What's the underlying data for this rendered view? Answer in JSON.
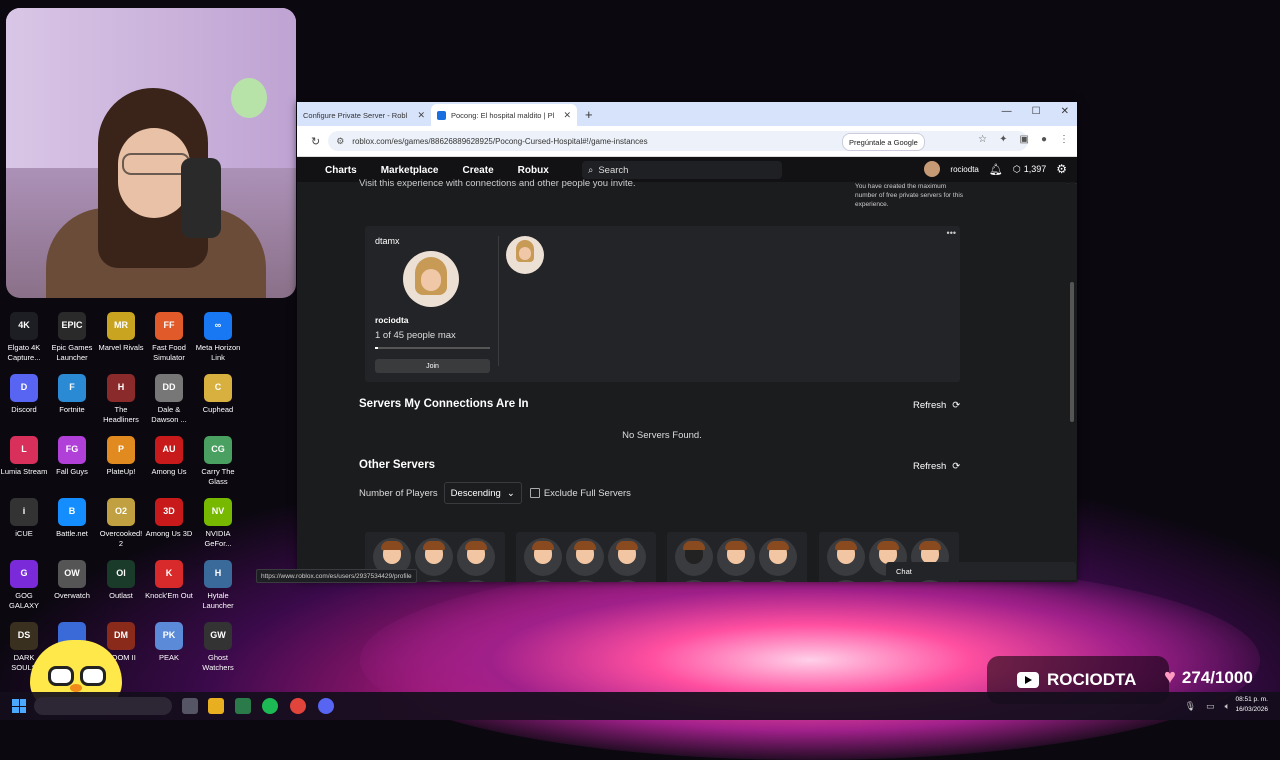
{
  "browser": {
    "tabs": [
      {
        "label": "Configure Private Server - Robl",
        "active": false
      },
      {
        "label": "Pocong: El hospital maldito | Pl",
        "active": true
      }
    ],
    "url": "roblox.com/es/games/88626889628925/Pocong-Cursed-Hospital#!/game-instances",
    "ask_google": "Pregúntale a Google",
    "status_url": "https://www.roblox.com/es/users/2937534429/profile"
  },
  "roblox_nav": {
    "links": [
      "Charts",
      "Marketplace",
      "Create",
      "Robux"
    ],
    "search_placeholder": "Search",
    "username": "rociodta",
    "robux": "1,397"
  },
  "page": {
    "intro": "Visit this experience with connections and other people you invite.",
    "private_note": "You have created the maximum number of free private servers for this experience.",
    "private_server": {
      "owner": "dtamx",
      "name": "rociodta",
      "capacity": "1 of 45 people max",
      "fill_fraction": 0.022,
      "join": "Join"
    },
    "connections": {
      "title": "Servers My Connections Are In",
      "refresh": "Refresh",
      "empty": "No Servers Found."
    },
    "other": {
      "title": "Other Servers",
      "refresh": "Refresh",
      "filter_label": "Number of Players",
      "sort": "Descending",
      "exclude": "Exclude Full Servers",
      "servers": [
        {
          "extra": "+33"
        },
        {
          "extra": "+29"
        },
        {
          "extra": "+28"
        },
        {
          "extra": ""
        }
      ]
    },
    "chat": "Chat"
  },
  "desktop_icons": [
    {
      "label": "Elgato 4K Capture...",
      "abbr": "4K",
      "color": "#1d1d24"
    },
    {
      "label": "Epic Games Launcher",
      "abbr": "EPIC",
      "color": "#2a2a2a"
    },
    {
      "label": "Marvel Rivals",
      "abbr": "MR",
      "color": "#c8a420"
    },
    {
      "label": "Fast Food Simulator",
      "abbr": "FF",
      "color": "#e05a2a"
    },
    {
      "label": "Meta Horizon Link",
      "abbr": "∞",
      "color": "#1877f2"
    },
    {
      "label": "Discord",
      "abbr": "D",
      "color": "#5865f2"
    },
    {
      "label": "Fortnite",
      "abbr": "F",
      "color": "#2a8ad4"
    },
    {
      "label": "The Headliners",
      "abbr": "H",
      "color": "#8a2a2a"
    },
    {
      "label": "Dale & Dawson ...",
      "abbr": "DD",
      "color": "#777"
    },
    {
      "label": "Cuphead",
      "abbr": "C",
      "color": "#d8b040"
    },
    {
      "label": "Lumia Stream",
      "abbr": "L",
      "color": "#d8305a"
    },
    {
      "label": "Fall Guys",
      "abbr": "FG",
      "color": "#b040d8"
    },
    {
      "label": "PlateUp!",
      "abbr": "P",
      "color": "#e08a20"
    },
    {
      "label": "Among Us",
      "abbr": "AU",
      "color": "#c81a1a"
    },
    {
      "label": "Carry The Glass",
      "abbr": "CG",
      "color": "#4aa060"
    },
    {
      "label": "iCUE",
      "abbr": "i",
      "color": "#333"
    },
    {
      "label": "Battle.net",
      "abbr": "B",
      "color": "#148eff"
    },
    {
      "label": "Overcooked! 2",
      "abbr": "O2",
      "color": "#c0a040"
    },
    {
      "label": "Among Us 3D",
      "abbr": "3D",
      "color": "#c81a1a"
    },
    {
      "label": "NVIDIA GeFor...",
      "abbr": "NV",
      "color": "#76b900"
    },
    {
      "label": "GOG GALAXY",
      "abbr": "G",
      "color": "#7a2ad8"
    },
    {
      "label": "Overwatch",
      "abbr": "OW",
      "color": "#555"
    },
    {
      "label": "Outlast",
      "abbr": "Ol",
      "color": "#1a3a2a"
    },
    {
      "label": "Knock'Em Out",
      "abbr": "K",
      "color": "#d82a2a"
    },
    {
      "label": "Hytale Launcher",
      "abbr": "H",
      "color": "#3a6a9a"
    },
    {
      "label": "DARK SOULS",
      "abbr": "DS",
      "color": "#3a3020"
    },
    {
      "label": "",
      "abbr": "",
      "color": "#3a6ad8"
    },
    {
      "label": "DOOM II",
      "abbr": "DM",
      "color": "#8a2a1a"
    },
    {
      "label": "PEAK",
      "abbr": "PK",
      "color": "#5a8ad8"
    },
    {
      "label": "Ghost Watchers",
      "abbr": "GW",
      "color": "#333"
    }
  ],
  "overlay": {
    "channel": "ROCIODTA",
    "goal": "274/1000"
  },
  "taskbar": {
    "time": "08:51 p. m.",
    "date": "16/03/2026"
  }
}
